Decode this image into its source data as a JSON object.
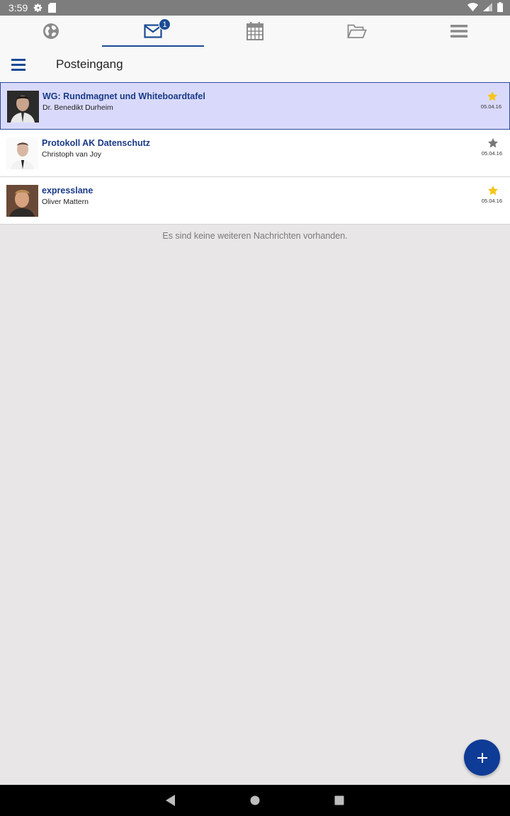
{
  "status_bar": {
    "time": "3:59",
    "icons_left": [
      "settings-icon",
      "sd-card-icon"
    ],
    "icons_right": [
      "wifi-icon",
      "signal-icon",
      "battery-icon"
    ]
  },
  "top_tabs": [
    {
      "icon": "globe-icon",
      "active": false
    },
    {
      "icon": "mail-icon",
      "active": true,
      "badge": "1"
    },
    {
      "icon": "calendar-icon",
      "active": false
    },
    {
      "icon": "folder-icon",
      "active": false
    },
    {
      "icon": "menu-icon",
      "active": false
    }
  ],
  "header": {
    "title": "Posteingang"
  },
  "messages": [
    {
      "subject": "WG: Rundmagnet und Whiteboardtafel",
      "sender": "Dr. Benedikt Durheim",
      "date": "05.04.16",
      "starred": true,
      "selected": true
    },
    {
      "subject": "Protokoll AK Datenschutz",
      "sender": "Christoph van Joy",
      "date": "05.04.16",
      "starred": false,
      "selected": false
    },
    {
      "subject": "expresslane",
      "sender": "Oliver Mattern",
      "date": "05.04.16",
      "starred": true,
      "selected": false
    }
  ],
  "no_more_text": "Es sind keine weiteren Nachrichten vorhanden.",
  "fab": {
    "icon": "plus-icon"
  },
  "nav_bar": {
    "icons": [
      "back-icon",
      "home-icon",
      "recents-icon"
    ]
  },
  "colors": {
    "accent": "#1a4b94",
    "selected_bg": "#d9dafb",
    "star_active": "#f5c518",
    "star_inactive": "#777777",
    "subject_text": "#1a3a86"
  }
}
